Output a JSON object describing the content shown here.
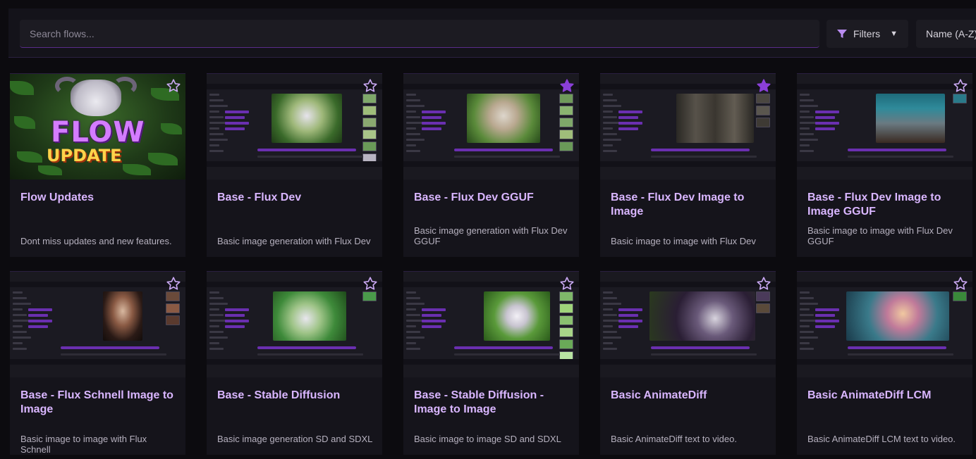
{
  "search": {
    "placeholder": "Search flows..."
  },
  "filters": {
    "label": "Filters",
    "caret": "▼",
    "icon": "funnel-icon"
  },
  "sort": {
    "label": "Name (A-Z)"
  },
  "colors": {
    "accent": "#8a3fd8",
    "title": "#d9b6ff",
    "star_filled": "#8a3fd8",
    "star_outline": "#c9a8f2"
  },
  "cards": [
    {
      "title": "Flow Updates",
      "description": "Dont miss updates and new features.",
      "favorite": false,
      "thumb": "hero",
      "hero_words": [
        "FLOW",
        "UPDATE"
      ]
    },
    {
      "title": "Base - Flux Dev",
      "description": "Basic image generation with Flux Dev",
      "favorite": false,
      "thumb": "goat-sign"
    },
    {
      "title": "Base - Flux Dev GGUF",
      "description": "Basic image generation with Flux Dev GGUF",
      "favorite": true,
      "thumb": "goat"
    },
    {
      "title": "Base - Flux Dev Image to Image",
      "description": "Basic image to image with Flux Dev",
      "favorite": true,
      "thumb": "men"
    },
    {
      "title": "Base - Flux Dev Image to Image GGUF",
      "description": "Basic image to image with Flux Dev GGUF",
      "favorite": false,
      "thumb": "man-desk"
    },
    {
      "title": "Base - Flux Schnell Image to Image",
      "description": "Basic image to image with Flux Schnell",
      "favorite": false,
      "thumb": "woman"
    },
    {
      "title": "Base - Stable Diffusion",
      "description": "Basic image generation SD and SDXL",
      "favorite": false,
      "thumb": "goat-jungle"
    },
    {
      "title": "Base - Stable Diffusion - Image to Image",
      "description": "Basic image to image SD and SDXL",
      "favorite": false,
      "thumb": "goat-white"
    },
    {
      "title": "Basic AnimateDiff",
      "description": "Basic AnimateDiff text to video.",
      "favorite": false,
      "thumb": "goat-dark"
    },
    {
      "title": "Basic AnimateDiff LCM",
      "description": "Basic AnimateDiff LCM text to video.",
      "favorite": false,
      "thumb": "cartoon"
    }
  ]
}
